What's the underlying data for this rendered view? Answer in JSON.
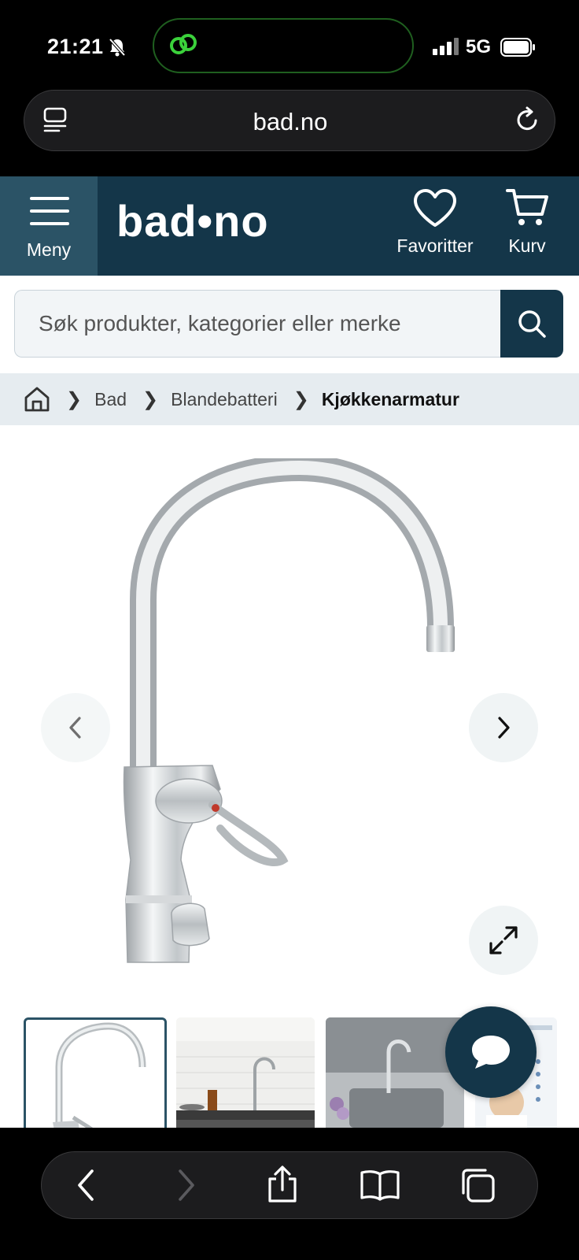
{
  "status_bar": {
    "time": "21:21",
    "network": "5G"
  },
  "browser": {
    "url": "bad.no"
  },
  "site_header": {
    "logo": "bad•no",
    "menu_label": "Meny",
    "favorites_label": "Favoritter",
    "cart_label": "Kurv",
    "brand_color": "#143649"
  },
  "search": {
    "placeholder": "Søk produkter, kategorier eller merke"
  },
  "breadcrumb": {
    "items": [
      "Bad",
      "Blandebatteri",
      "Kjøkkenarmatur"
    ]
  },
  "product": {
    "image_name": "chrome-kitchen-faucet",
    "thumbnails": [
      "faucet-closeup",
      "kitchen-counter-faucet",
      "steel-sink-faucet",
      "product-sheet"
    ]
  },
  "icons": {
    "bell_muted": "bell-slash-icon",
    "tabs": "tabs-icon",
    "reload": "reload-icon",
    "menu": "hamburger-icon",
    "favorites": "heart-icon",
    "cart": "cart-icon",
    "search": "search-icon",
    "home": "home-icon",
    "chat": "chat-icon",
    "back": "back-icon",
    "forward": "forward-icon",
    "share": "share-icon",
    "bookmarks": "book-icon",
    "tab_overview": "tabs-overview-icon"
  }
}
